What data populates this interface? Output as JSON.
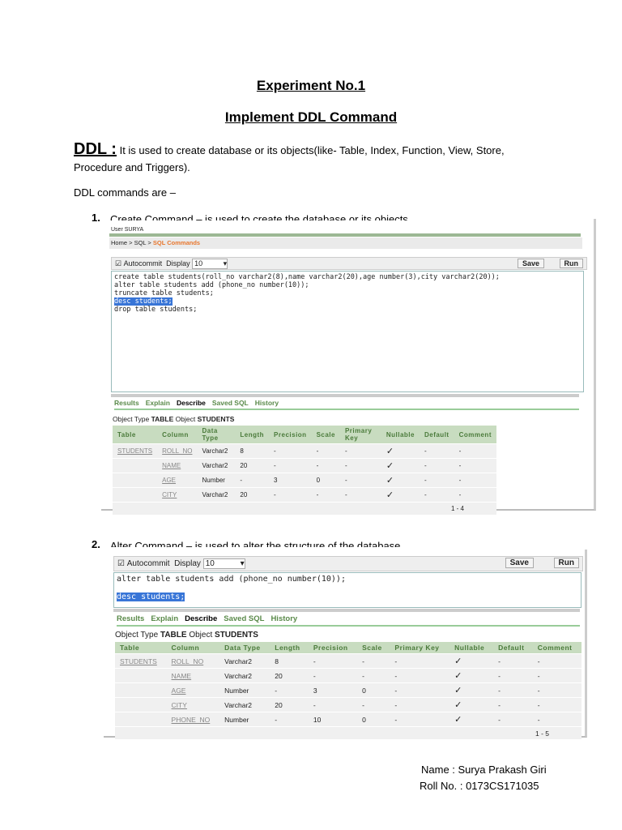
{
  "heading": {
    "title": "Experiment No.1",
    "subtitle": "Implement DDL Command"
  },
  "intro": {
    "term": "DDL :",
    "text": " It is used to create database or its objects(like- Table, Index, Function, View, Store, Procedure and Triggers).",
    "list_intro": "DDL commands are –"
  },
  "items": [
    {
      "num": "1.",
      "text": "Create Command – is used to create the database or its objects"
    },
    {
      "num": "2.",
      "text": "Alter Command – is used to alter the structure of the database"
    }
  ],
  "shot1": {
    "user": "User SURYA",
    "breadcrumb": [
      "Home",
      "SQL",
      "SQL Commands"
    ],
    "autocommit": "Autocommit",
    "display_label": "Display",
    "display_value": "10",
    "save": "Save",
    "run": "Run",
    "code": [
      "create table students(roll_no varchar2(8),name varchar2(20),age number(3),city varchar2(20));",
      "alter table students add (phone_no number(10));",
      "truncate table students;"
    ],
    "code_selected": "desc students;",
    "code_after": "drop table students;",
    "tabs": [
      "Results",
      "Explain",
      "Describe",
      "Saved SQL",
      "History"
    ],
    "obj_type_label": "Object Type",
    "obj_type": "TABLE",
    "obj_label": "Object",
    "obj": "STUDENTS",
    "columns": [
      "Table",
      "Column",
      "Data Type",
      "Length",
      "Precision",
      "Scale",
      "Primary Key",
      "Nullable",
      "Default",
      "Comment"
    ],
    "rows": [
      [
        "STUDENTS",
        "ROLL_NO",
        "Varchar2",
        "8",
        "-",
        "-",
        "-",
        "✓",
        "-",
        "-"
      ],
      [
        "",
        "NAME",
        "Varchar2",
        "20",
        "-",
        "-",
        "-",
        "✓",
        "-",
        "-"
      ],
      [
        "",
        "AGE",
        "Number",
        "-",
        "3",
        "0",
        "-",
        "✓",
        "-",
        "-"
      ],
      [
        "",
        "CITY",
        "Varchar2",
        "20",
        "-",
        "-",
        "-",
        "✓",
        "-",
        "-"
      ]
    ],
    "pager": "1 - 4"
  },
  "shot2": {
    "autocommit": "Autocommit",
    "display_label": "Display",
    "display_value": "10",
    "save": "Save",
    "run": "Run",
    "code": [
      "alter table students add (phone_no number(10));",
      ""
    ],
    "code_selected": "desc students;",
    "code_after": "",
    "tabs": [
      "Results",
      "Explain",
      "Describe",
      "Saved SQL",
      "History"
    ],
    "obj_type_label": "Object Type",
    "obj_type": "TABLE",
    "obj_label": "Object",
    "obj": "STUDENTS",
    "columns": [
      "Table",
      "Column",
      "Data Type",
      "Length",
      "Precision",
      "Scale",
      "Primary Key",
      "Nullable",
      "Default",
      "Comment"
    ],
    "rows": [
      [
        "STUDENTS",
        "ROLL_NO",
        "Varchar2",
        "8",
        "-",
        "-",
        "-",
        "✓",
        "-",
        "-"
      ],
      [
        "",
        "NAME",
        "Varchar2",
        "20",
        "-",
        "-",
        "-",
        "✓",
        "-",
        "-"
      ],
      [
        "",
        "AGE",
        "Number",
        "-",
        "3",
        "0",
        "-",
        "✓",
        "-",
        "-"
      ],
      [
        "",
        "CITY",
        "Varchar2",
        "20",
        "-",
        "-",
        "-",
        "✓",
        "-",
        "-"
      ],
      [
        "",
        "PHONE_NO",
        "Number",
        "-",
        "10",
        "0",
        "-",
        "✓",
        "-",
        "-"
      ]
    ],
    "pager": "1 - 5"
  },
  "footer": {
    "name": "Name : Surya Prakash Giri",
    "roll": "Roll No. : 0173CS171035"
  }
}
